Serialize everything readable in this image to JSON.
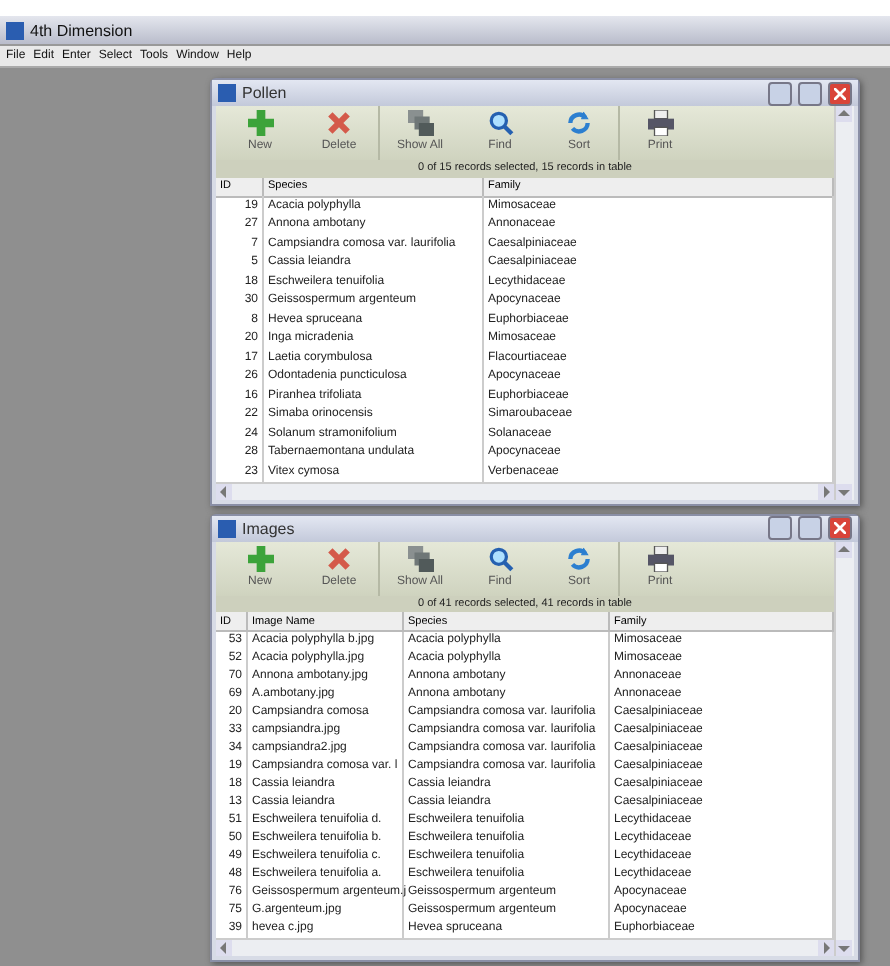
{
  "app": {
    "title": "4th Dimension",
    "menu": [
      "File",
      "Edit",
      "Enter",
      "Select",
      "Tools",
      "Window",
      "Help"
    ]
  },
  "windows": [
    {
      "title": "Pollen",
      "toolbar": [
        {
          "kind": "new",
          "label": "New"
        },
        {
          "kind": "delete",
          "label": "Delete"
        },
        {
          "kind": "showall",
          "label": "Show All"
        },
        {
          "kind": "find",
          "label": "Find"
        },
        {
          "kind": "sort",
          "label": "Sort"
        },
        {
          "kind": "print",
          "label": "Print"
        }
      ],
      "status": "0 of 15 records selected, 15 records in table",
      "columns": [
        "ID",
        "Species",
        "Family"
      ],
      "rows": [
        [
          "19",
          "Acacia polyphylla",
          "Mimosaceae"
        ],
        [
          "27",
          "Annona ambotany",
          "Annonaceae"
        ],
        [
          "7",
          "Campsiandra comosa var. laurifolia",
          "Caesalpiniaceae"
        ],
        [
          "5",
          "Cassia leiandra",
          "Caesalpiniaceae"
        ],
        [
          "18",
          "Eschweilera tenuifolia",
          "Lecythidaceae"
        ],
        [
          "30",
          "Geissospermum argenteum",
          "Apocynaceae"
        ],
        [
          "8",
          "Hevea spruceana",
          "Euphorbiaceae"
        ],
        [
          "20",
          "Inga micradenia",
          "Mimosaceae"
        ],
        [
          "17",
          "Laetia corymbulosa",
          "Flacourtiaceae"
        ],
        [
          "26",
          "Odontadenia puncticulosa",
          "Apocynaceae"
        ],
        [
          "16",
          "Piranhea trifoliata",
          "Euphorbiaceae"
        ],
        [
          "22",
          "Simaba orinocensis",
          "Simaroubaceae"
        ],
        [
          "24",
          "Solanum stramonifolium",
          "Solanaceae"
        ],
        [
          "28",
          "Tabernaemontana undulata",
          "Apocynaceae"
        ],
        [
          "23",
          "Vitex cymosa",
          "Verbenaceae"
        ]
      ]
    },
    {
      "title": "Images",
      "toolbar": [
        {
          "kind": "new",
          "label": "New"
        },
        {
          "kind": "delete",
          "label": "Delete"
        },
        {
          "kind": "showall",
          "label": "Show All"
        },
        {
          "kind": "find",
          "label": "Find"
        },
        {
          "kind": "sort",
          "label": "Sort"
        },
        {
          "kind": "print",
          "label": "Print"
        }
      ],
      "status": "0 of 41 records selected, 41 records in table",
      "columns": [
        "ID",
        "Image Name",
        "Species",
        "Family"
      ],
      "rows": [
        [
          "53",
          "Acacia polyphylla b.jpg",
          "Acacia polyphylla",
          "Mimosaceae"
        ],
        [
          "52",
          "Acacia polyphylla.jpg",
          "Acacia polyphylla",
          "Mimosaceae"
        ],
        [
          "70",
          "Annona ambotany.jpg",
          "Annona ambotany",
          "Annonaceae"
        ],
        [
          "69",
          "A.ambotany.jpg",
          "Annona ambotany",
          "Annonaceae"
        ],
        [
          "20",
          "Campsiandra comosa",
          "Campsiandra comosa var. laurifolia",
          "Caesalpiniaceae"
        ],
        [
          "33",
          "campsiandra.jpg",
          "Campsiandra comosa var. laurifolia",
          "Caesalpiniaceae"
        ],
        [
          "34",
          "campsiandra2.jpg",
          "Campsiandra comosa var. laurifolia",
          "Caesalpiniaceae"
        ],
        [
          "19",
          "Campsiandra comosa var. l",
          "Campsiandra comosa var. laurifolia",
          "Caesalpiniaceae"
        ],
        [
          "18",
          "Cassia leiandra",
          "Cassia leiandra",
          "Caesalpiniaceae"
        ],
        [
          "13",
          "Cassia leiandra",
          "Cassia leiandra",
          "Caesalpiniaceae"
        ],
        [
          "51",
          "Eschweilera tenuifolia d.",
          "Eschweilera tenuifolia",
          "Lecythidaceae"
        ],
        [
          "50",
          "Eschweilera tenuifolia b.",
          "Eschweilera tenuifolia",
          "Lecythidaceae"
        ],
        [
          "49",
          "Eschweilera tenuifolia c.",
          "Eschweilera tenuifolia",
          "Lecythidaceae"
        ],
        [
          "48",
          "Eschweilera tenuifolia a.",
          "Eschweilera tenuifolia",
          "Lecythidaceae"
        ],
        [
          "76",
          "Geissospermum argenteum.j",
          "Geissospermum argenteum",
          "Apocynaceae"
        ],
        [
          "75",
          "G.argenteum.jpg",
          "Geissospermum argenteum",
          "Apocynaceae"
        ],
        [
          "39",
          "hevea c.jpg",
          "Hevea spruceana",
          "Euphorbiaceae"
        ]
      ]
    }
  ]
}
